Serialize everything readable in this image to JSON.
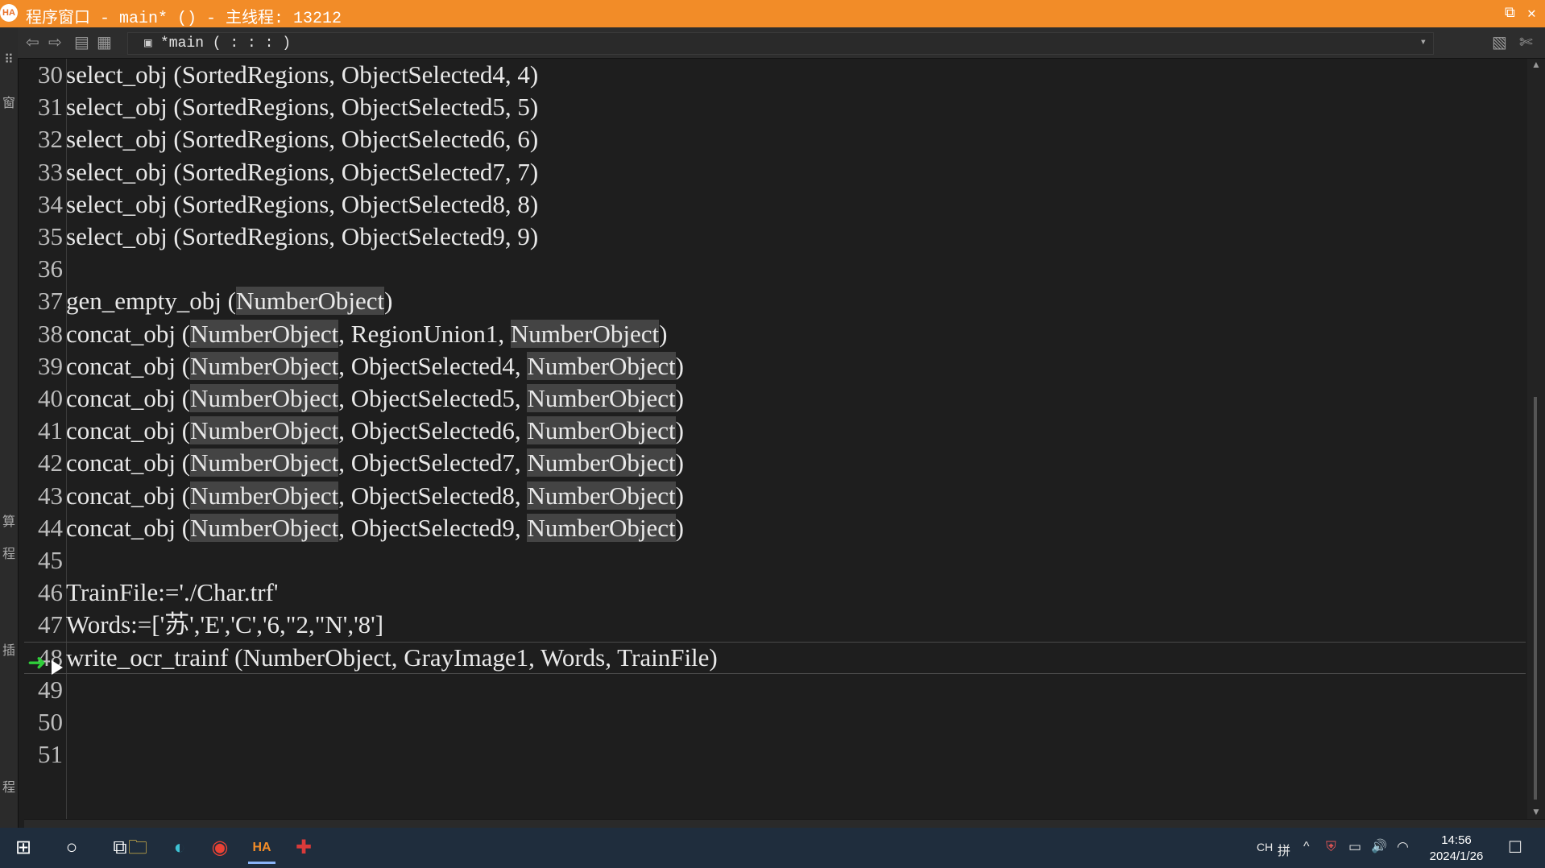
{
  "window": {
    "title": "程序窗口 - main* () - 主线程: 13212",
    "app_icon_text": "HA",
    "restore_glyph": "⧉",
    "close_glyph": "✕"
  },
  "left_strip": {
    "glyphs": [
      "⠿",
      "窗",
      "算",
      "程",
      "插",
      "程"
    ]
  },
  "toolbar": {
    "back_glyph": "⇦",
    "forward_glyph": "⇨",
    "procedure_label": "*main ( : : : )",
    "dropdown_glyph": "▾"
  },
  "editor": {
    "current_line": 48,
    "lines": [
      {
        "n": "30",
        "text": "select_obj (SortedRegions, ObjectSelected4, 4)"
      },
      {
        "n": "31",
        "text": "select_obj (SortedRegions, ObjectSelected5, 5)"
      },
      {
        "n": "32",
        "text": "select_obj (SortedRegions, ObjectSelected6, 6)"
      },
      {
        "n": "33",
        "text": "select_obj (SortedRegions, ObjectSelected7, 7)"
      },
      {
        "n": "34",
        "text": "select_obj (SortedRegions, ObjectSelected8, 8)"
      },
      {
        "n": "35",
        "text": "select_obj (SortedRegions, ObjectSelected9, 9)"
      },
      {
        "n": "36",
        "text": ""
      },
      {
        "n": "37",
        "parts": [
          {
            "t": "gen_empty_obj ("
          },
          {
            "t": "NumberObject",
            "hl": true
          },
          {
            "t": ")"
          }
        ]
      },
      {
        "n": "38",
        "parts": [
          {
            "t": "concat_obj ("
          },
          {
            "t": "NumberObject",
            "hl": true
          },
          {
            "t": ", RegionUnion1, "
          },
          {
            "t": "NumberObject",
            "hl": true
          },
          {
            "t": ")"
          }
        ]
      },
      {
        "n": "39",
        "parts": [
          {
            "t": "concat_obj ("
          },
          {
            "t": "NumberObject",
            "hl": true
          },
          {
            "t": ", ObjectSelected4, "
          },
          {
            "t": "NumberObject",
            "hl": true
          },
          {
            "t": ")"
          }
        ]
      },
      {
        "n": "40",
        "parts": [
          {
            "t": "concat_obj ("
          },
          {
            "t": "NumberObject",
            "hl": true
          },
          {
            "t": ", ObjectSelected5, "
          },
          {
            "t": "NumberObject",
            "hl": true
          },
          {
            "t": ")"
          }
        ]
      },
      {
        "n": "41",
        "parts": [
          {
            "t": "concat_obj ("
          },
          {
            "t": "NumberObject",
            "hl": true
          },
          {
            "t": ", ObjectSelected6, "
          },
          {
            "t": "NumberObject",
            "hl": true
          },
          {
            "t": ")"
          }
        ]
      },
      {
        "n": "42",
        "parts": [
          {
            "t": "concat_obj ("
          },
          {
            "t": "NumberObject",
            "hl": true
          },
          {
            "t": ", ObjectSelected7, "
          },
          {
            "t": "NumberObject",
            "hl": true
          },
          {
            "t": ")"
          }
        ]
      },
      {
        "n": "43",
        "parts": [
          {
            "t": "concat_obj ("
          },
          {
            "t": "NumberObject",
            "hl": true
          },
          {
            "t": ", ObjectSelected8, "
          },
          {
            "t": "NumberObject",
            "hl": true
          },
          {
            "t": ")"
          }
        ]
      },
      {
        "n": "44",
        "parts": [
          {
            "t": "concat_obj ("
          },
          {
            "t": "NumberObject",
            "hl": true
          },
          {
            "t": ", ObjectSelected9, "
          },
          {
            "t": "NumberObject",
            "hl": true
          },
          {
            "t": ")"
          }
        ]
      },
      {
        "n": "45",
        "text": ""
      },
      {
        "n": "46",
        "text": "TrainFile:='./Char.trf'"
      },
      {
        "n": "47",
        "text": "Words:=['苏','E','C','6,\"2,\"N','8']"
      },
      {
        "n": "48",
        "text": "write_ocr_trainf (NumberObject, GrayImage1, Words, TrainFile)",
        "current": true
      },
      {
        "n": "49",
        "text": ""
      },
      {
        "n": "50",
        "text": ""
      },
      {
        "n": "51",
        "text": ""
      }
    ],
    "exec_marker_glyph": "➜"
  },
  "taskbar": {
    "start_glyph": "⊞",
    "search_glyph": "○",
    "taskview_glyph": "⧉",
    "apps": [
      {
        "name": "file-explorer-icon",
        "glyph": "🗀",
        "color": "#f2c94c"
      },
      {
        "name": "edge-icon",
        "glyph": "◐",
        "color": "#3ec1d3"
      },
      {
        "name": "chrome-icon",
        "glyph": "◉",
        "color": "#e94235"
      },
      {
        "name": "halcon-icon",
        "glyph": "HA",
        "color": "#f28c28"
      },
      {
        "name": "app-icon",
        "glyph": "✚",
        "color": "#d93a3a"
      }
    ],
    "tray": {
      "lang": "CH",
      "ime": "拼",
      "chevron": "^",
      "volume": "🔊",
      "wifi": "◠",
      "notification": "☐"
    },
    "clock": {
      "time": "14:56",
      "date": "2024/1/26"
    }
  }
}
